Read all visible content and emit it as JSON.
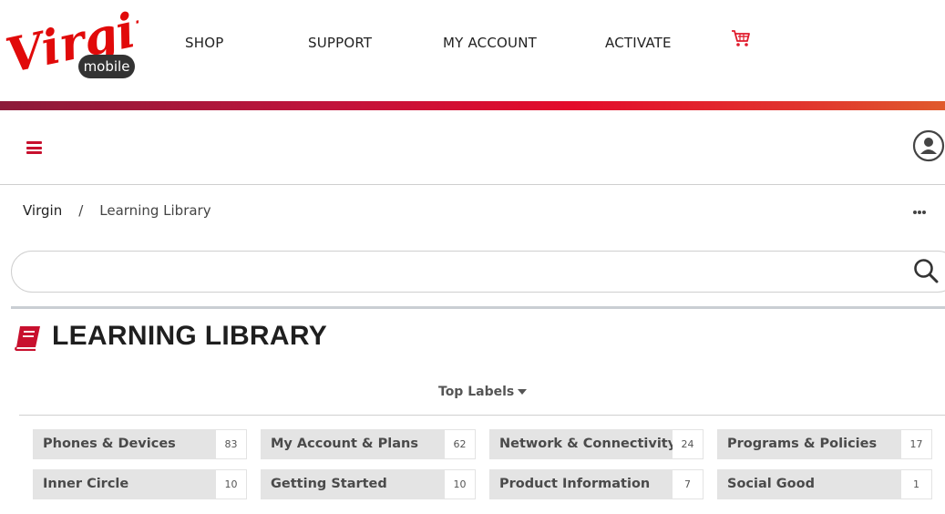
{
  "header": {
    "logo": {
      "brand": "Virgin",
      "sub": "mobile"
    },
    "nav": [
      "SHOP",
      "SUPPORT",
      "MY ACCOUNT",
      "ACTIVATE"
    ]
  },
  "breadcrumb": {
    "root": "Virgin",
    "separator": "/",
    "current": "Learning Library"
  },
  "search": {
    "placeholder": "",
    "value": ""
  },
  "page": {
    "title": "LEARNING LIBRARY"
  },
  "labels": {
    "heading": "Top Labels",
    "items": [
      {
        "name": "Phones & Devices",
        "count": "83"
      },
      {
        "name": "My Account & Plans",
        "count": "62"
      },
      {
        "name": "Network & Connectivity",
        "count": "24"
      },
      {
        "name": "Programs & Policies",
        "count": "17"
      },
      {
        "name": "Inner Circle",
        "count": "10"
      },
      {
        "name": "Getting Started",
        "count": "10"
      },
      {
        "name": "Product Information",
        "count": "7"
      },
      {
        "name": "Social Good",
        "count": "1"
      }
    ]
  },
  "colors": {
    "brand_red": "#c8102e",
    "chip_bg": "#e4e4e4"
  },
  "icons": {
    "cart": "cart-icon",
    "menu": "hamburger-menu-icon",
    "user": "user-icon",
    "more": "more-icon",
    "search": "search-icon",
    "book": "book-icon"
  }
}
